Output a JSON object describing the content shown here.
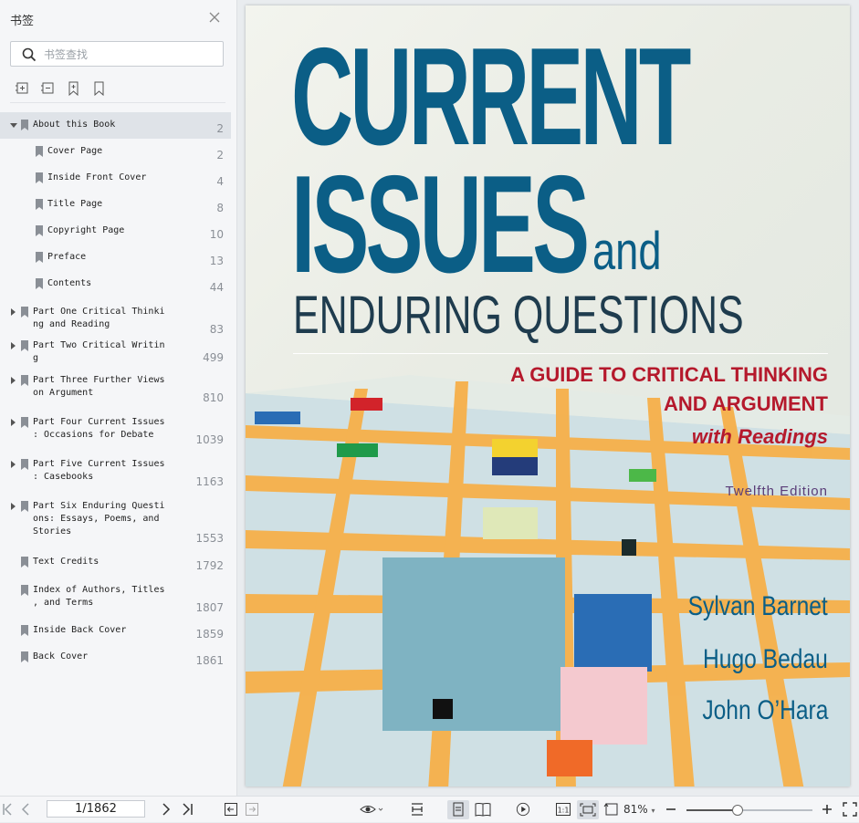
{
  "sidebar": {
    "title": "书签",
    "search_placeholder": "书签查找",
    "bookmarks": [
      {
        "label": "About this Book",
        "page": "2"
      },
      {
        "label": "Cover Page",
        "page": "2"
      },
      {
        "label": "Inside Front Cover",
        "page": "4"
      },
      {
        "label": "Title Page",
        "page": "8"
      },
      {
        "label": "Copyright Page",
        "page": "10"
      },
      {
        "label": "Preface",
        "page": "13"
      },
      {
        "label": "Contents",
        "page": "44"
      },
      {
        "label": "Part One Critical Thinki\nng and Reading",
        "page": "83"
      },
      {
        "label": "Part Two Critical Writin\ng",
        "page": "499"
      },
      {
        "label": "Part Three Further Views\non Argument",
        "page": "810"
      },
      {
        "label": "Part Four Current Issues\n: Occasions for Debate",
        "page": "1039"
      },
      {
        "label": "Part Five Current Issues\n: Casebooks",
        "page": "1163"
      },
      {
        "label": "Part Six Enduring Questi\nons: Essays, Poems, and\nStories",
        "page": "1553"
      },
      {
        "label": "Text Credits",
        "page": "1792"
      },
      {
        "label": "Index of Authors, Titles\n, and Terms",
        "page": "1807"
      },
      {
        "label": "Inside Back Cover",
        "page": "1859"
      },
      {
        "label": "Back Cover",
        "page": "1861"
      }
    ]
  },
  "cover": {
    "line1": "CURRENT",
    "line2": "ISSUES",
    "and": "and",
    "line3": "ENDURING QUESTIONS",
    "subtitle1": "A GUIDE TO CRITICAL THINKING",
    "subtitle2": "AND ARGUMENT",
    "subtitle3": "with Readings",
    "edition": "Twelfth Edition",
    "authors": [
      "Sylvan Barnet",
      "Hugo Bedau",
      "John O’Hara"
    ]
  },
  "toolbar": {
    "page_indicator": "1/1862",
    "zoom": "81%"
  }
}
